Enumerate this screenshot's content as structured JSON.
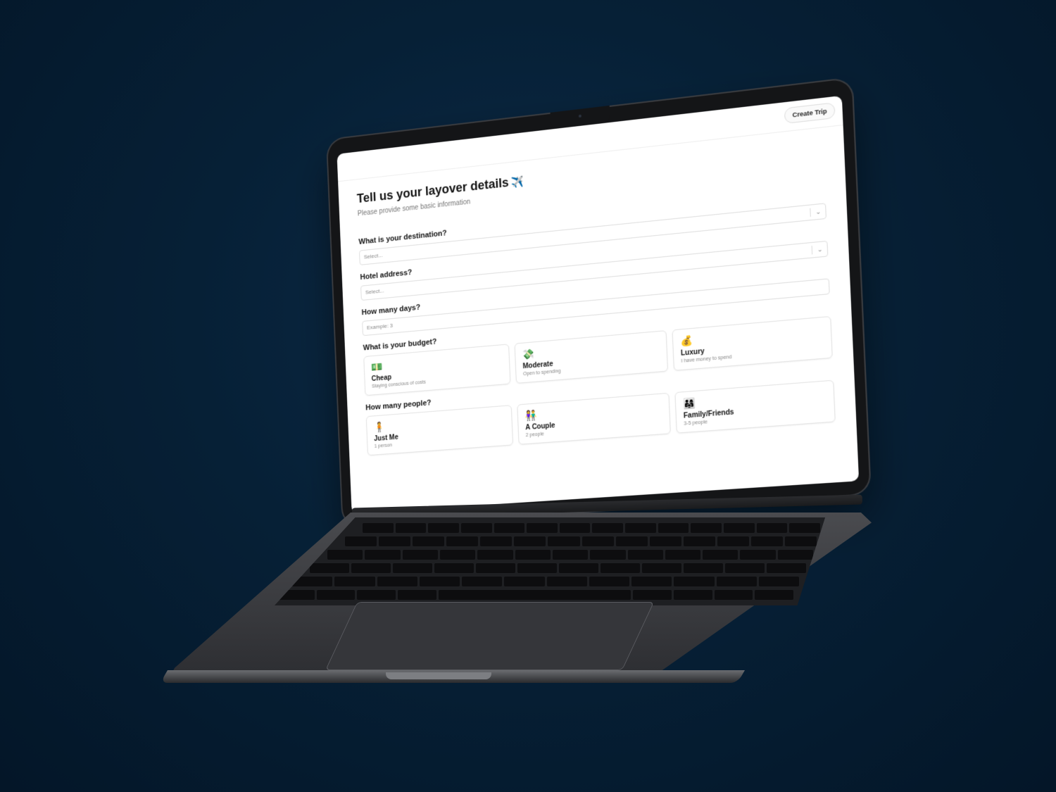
{
  "app": {
    "create_trip_label": "Create Trip",
    "title": "Tell us your layover details",
    "title_icon": "✈️",
    "subtitle": "Please provide some basic information"
  },
  "form": {
    "destination": {
      "label": "What is your destination?",
      "placeholder": "Select..."
    },
    "hotel": {
      "label": "Hotel address?",
      "placeholder": "Select..."
    },
    "days": {
      "label": "How many days?",
      "placeholder": "Example: 3"
    },
    "budget": {
      "label": "What is your budget?",
      "options": [
        {
          "icon": "💵",
          "title": "Cheap",
          "desc": "Staying conscious of costs"
        },
        {
          "icon": "💸",
          "title": "Moderate",
          "desc": "Open to spending"
        },
        {
          "icon": "💰",
          "title": "Luxury",
          "desc": "I have money to spend"
        }
      ]
    },
    "people": {
      "label": "How many people?",
      "options": [
        {
          "icon": "🧍",
          "title": "Just Me",
          "desc": "1 person"
        },
        {
          "icon": "👫",
          "title": "A Couple",
          "desc": "2 people"
        },
        {
          "icon": "👨‍👩‍👧",
          "title": "Family/Friends",
          "desc": "3-5 people"
        }
      ]
    }
  }
}
